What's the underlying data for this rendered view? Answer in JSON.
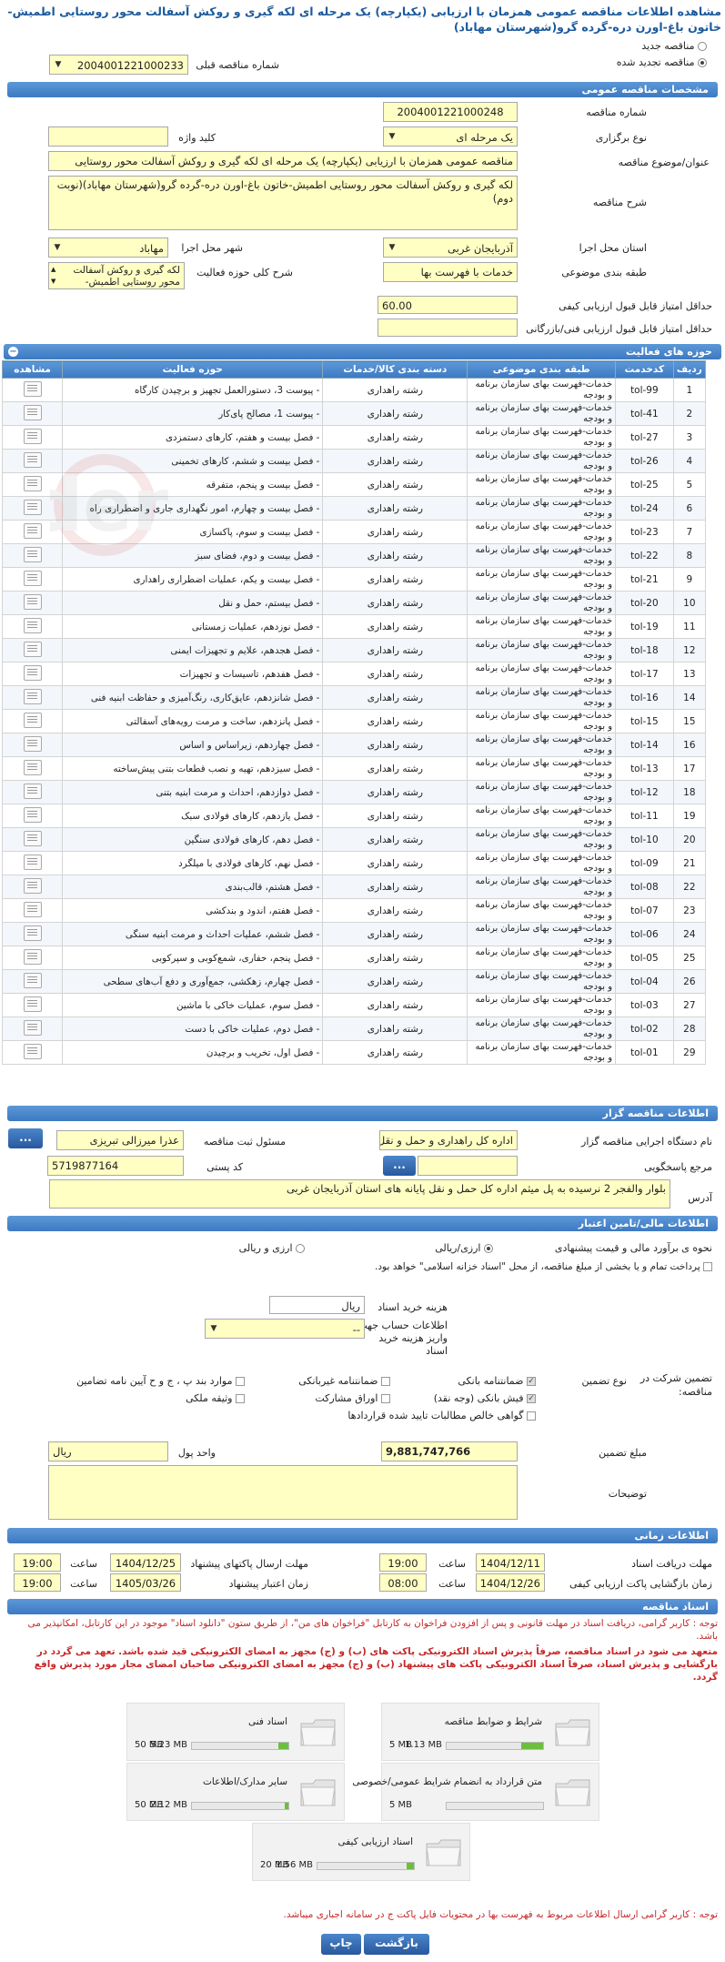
{
  "page": {
    "title": "مشاهده اطلاعات مناقصه عمومی همزمان با ارزیابی (یکپارچه) یک مرحله ای لکه گیری و روکش آسفالت محور روستایی اطمیش-خاتون باغ-اورن دره-گرده گرو(شهرستان مهاباد)"
  },
  "top": {
    "radio_new": "مناقصه جدید",
    "radio_renewed": "مناقصه تجدید شده",
    "prev_number_label": "شماره مناقصه قبلی",
    "prev_number_value": "2004001221000233"
  },
  "general": {
    "header": "مشخصات مناقصه عمومی",
    "number_label": "شماره مناقصه",
    "number_value": "2004001221000248",
    "type_label": "نوع برگزاری",
    "type_value": "یک مرحله ای",
    "keyword_label": "کلید واژه",
    "keyword_value": "",
    "subject_label": "عنوان/موضوع مناقصه",
    "subject_value": "مناقصه عمومی همزمان با ارزیابی (یکپارچه) یک مرحله ای لکه گیری و روکش آسفالت محور روستایی",
    "desc_label": "شرح مناقصه",
    "desc_value": "لکه گیری و روکش آسفالت محور روستایی اطمیش-خاتون باغ-اورن دره-گرده گرو(شهرستان مهاباد)(نوبت دوم)",
    "province_label": "استان محل اجرا",
    "province_value": "آذربایجان غربی",
    "city_label": "شهر محل اجرا",
    "city_value": "مهاباد",
    "category_label": "طبقه بندی موضوعی",
    "category_value": "خدمات با فهرست بها",
    "scope_label": "شرح کلی حوزه فعالیت",
    "scope_value": "لکه گیری و روکش آسفالت محور روستایی اطمیش-",
    "min_quality_label": "حداقل امتیاز قابل قبول ارزیابی کیفی",
    "min_quality_value": "60.00",
    "min_tech_label": "حداقل امتیاز قابل قبول ارزیابی فنی/بازرگانی",
    "min_tech_value": ""
  },
  "activities": {
    "header": "حوزه های فعالیت",
    "columns": [
      "ردیف",
      "کدخدمت",
      "طبقه بندی موضوعی",
      "دسته بندی کالا/خدمات",
      "حوزه فعالیت",
      "مشاهده"
    ],
    "rows": [
      {
        "idx": "1",
        "code": "tol-99",
        "cat": "خدمات-فهرست بهای سازمان برنامه و بودجه",
        "goods": "رشته راهداری",
        "act": "- پیوست 3، دستورالعمل تجهیز و برچیدن کارگاه"
      },
      {
        "idx": "2",
        "code": "tol-41",
        "cat": "خدمات-فهرست بهای سازمان برنامه و بودجه",
        "goods": "رشته راهداری",
        "act": "- پیوست 1، مصالح پای‌کار"
      },
      {
        "idx": "3",
        "code": "tol-27",
        "cat": "خدمات-فهرست بهای سازمان برنامه و بودجه",
        "goods": "رشته راهداری",
        "act": "- فصل بیست و هفتم، کارهای دستمزدی"
      },
      {
        "idx": "4",
        "code": "tol-26",
        "cat": "خدمات-فهرست بهای سازمان برنامه و بودجه",
        "goods": "رشته راهداری",
        "act": "- فصل بیست و ششم، کارهای تخمینی"
      },
      {
        "idx": "5",
        "code": "tol-25",
        "cat": "خدمات-فهرست بهای سازمان برنامه و بودجه",
        "goods": "رشته راهداری",
        "act": "- فصل بیست و پنجم، متفرقه"
      },
      {
        "idx": "6",
        "code": "tol-24",
        "cat": "خدمات-فهرست بهای سازمان برنامه و بودجه",
        "goods": "رشته راهداری",
        "act": "- فصل بیست و چهارم، امور نگهداری جاری و اضطراری راه"
      },
      {
        "idx": "7",
        "code": "tol-23",
        "cat": "خدمات-فهرست بهای سازمان برنامه و بودجه",
        "goods": "رشته راهداری",
        "act": "- فصل بیست و سوم، پاکسازی"
      },
      {
        "idx": "8",
        "code": "tol-22",
        "cat": "خدمات-فهرست بهای سازمان برنامه و بودجه",
        "goods": "رشته راهداری",
        "act": "- فصل بیست و دوم، فضای سبز"
      },
      {
        "idx": "9",
        "code": "tol-21",
        "cat": "خدمات-فهرست بهای سازمان برنامه و بودجه",
        "goods": "رشته راهداری",
        "act": "- فصل بیست و یکم، عملیات اضطراری راهداری"
      },
      {
        "idx": "10",
        "code": "tol-20",
        "cat": "خدمات-فهرست بهای سازمان برنامه و بودجه",
        "goods": "رشته راهداری",
        "act": "- فصل بیستم، حمل و نقل"
      },
      {
        "idx": "11",
        "code": "tol-19",
        "cat": "خدمات-فهرست بهای سازمان برنامه و بودجه",
        "goods": "رشته راهداری",
        "act": "- فصل نوزدهم، عملیات زمستانی"
      },
      {
        "idx": "12",
        "code": "tol-18",
        "cat": "خدمات-فهرست بهای سازمان برنامه و بودجه",
        "goods": "رشته راهداری",
        "act": "- فصل هجدهم، علایم و تجهیزات ایمنی"
      },
      {
        "idx": "13",
        "code": "tol-17",
        "cat": "خدمات-فهرست بهای سازمان برنامه و بودجه",
        "goods": "رشته راهداری",
        "act": "- فصل هفدهم، تاسیسات و تجهیزات"
      },
      {
        "idx": "14",
        "code": "tol-16",
        "cat": "خدمات-فهرست بهای سازمان برنامه و بودجه",
        "goods": "رشته راهداری",
        "act": "- فصل شانزدهم، عایق‌کاری، رنگ‌آمیزی و حفاظت ابنیه فنی"
      },
      {
        "idx": "15",
        "code": "tol-15",
        "cat": "خدمات-فهرست بهای سازمان برنامه و بودجه",
        "goods": "رشته راهداری",
        "act": "- فصل پانزدهم، ساخت و مرمت رویه‌های آسفالتی"
      },
      {
        "idx": "16",
        "code": "tol-14",
        "cat": "خدمات-فهرست بهای سازمان برنامه و بودجه",
        "goods": "رشته راهداری",
        "act": "- فصل چهاردهم، زیراساس و اساس"
      },
      {
        "idx": "17",
        "code": "tol-13",
        "cat": "خدمات-فهرست بهای سازمان برنامه و بودجه",
        "goods": "رشته راهداری",
        "act": "- فصل سیزدهم، تهیه و نصب قطعات بتنی پیش‌ساخته"
      },
      {
        "idx": "18",
        "code": "tol-12",
        "cat": "خدمات-فهرست بهای سازمان برنامه و بودجه",
        "goods": "رشته راهداری",
        "act": "- فصل دوازدهم، احداث و مرمت ابنیه بتنی"
      },
      {
        "idx": "19",
        "code": "tol-11",
        "cat": "خدمات-فهرست بهای سازمان برنامه و بودجه",
        "goods": "رشته راهداری",
        "act": "- فصل یازدهم، کارهای فولادی سبک"
      },
      {
        "idx": "20",
        "code": "tol-10",
        "cat": "خدمات-فهرست بهای سازمان برنامه و بودجه",
        "goods": "رشته راهداری",
        "act": "- فصل دهم، کارهای فولادی سنگین"
      },
      {
        "idx": "21",
        "code": "tol-09",
        "cat": "خدمات-فهرست بهای سازمان برنامه و بودجه",
        "goods": "رشته راهداری",
        "act": "- فصل نهم، کارهای فولادی با میلگرد"
      },
      {
        "idx": "22",
        "code": "tol-08",
        "cat": "خدمات-فهرست بهای سازمان برنامه و بودجه",
        "goods": "رشته راهداری",
        "act": "- فصل هشتم، قالب‌بندی"
      },
      {
        "idx": "23",
        "code": "tol-07",
        "cat": "خدمات-فهرست بهای سازمان برنامه و بودجه",
        "goods": "رشته راهداری",
        "act": "- فصل هفتم، اندود و بندکشی"
      },
      {
        "idx": "24",
        "code": "tol-06",
        "cat": "خدمات-فهرست بهای سازمان برنامه و بودجه",
        "goods": "رشته راهداری",
        "act": "- فصل ششم، عملیات احداث و مرمت ابنیه سنگی"
      },
      {
        "idx": "25",
        "code": "tol-05",
        "cat": "خدمات-فهرست بهای سازمان برنامه و بودجه",
        "goods": "رشته راهداری",
        "act": "- فصل پنجم، حفاری، شمع‌کوبی و سپرکوبی"
      },
      {
        "idx": "26",
        "code": "tol-04",
        "cat": "خدمات-فهرست بهای سازمان برنامه و بودجه",
        "goods": "رشته راهداری",
        "act": "- فصل چهارم، زهکشی، جمع‌آوری و دفع آب‌های سطحی"
      },
      {
        "idx": "27",
        "code": "tol-03",
        "cat": "خدمات-فهرست بهای سازمان برنامه و بودجه",
        "goods": "رشته راهداری",
        "act": "- فصل سوم، عملیات خاکی با ماشین"
      },
      {
        "idx": "28",
        "code": "tol-02",
        "cat": "خدمات-فهرست بهای سازمان برنامه و بودجه",
        "goods": "رشته راهداری",
        "act": "- فصل دوم، عملیات خاکی با دست"
      },
      {
        "idx": "29",
        "code": "tol-01",
        "cat": "خدمات-فهرست بهای سازمان برنامه و بودجه",
        "goods": "رشته راهداری",
        "act": "- فصل اول، تخریب و برچیدن"
      }
    ]
  },
  "organizer": {
    "header": "اطلاعات مناقصه گزار",
    "org_label": "نام دستگاه اجرایی مناقصه گزار",
    "org_value": "اداره کل راهداری و حمل و نقل",
    "resp_label": "مسئول ثبت مناقصه",
    "resp_value": "عذرا میرزالی تبریزی",
    "ref_label": "مرجع پاسخگویی",
    "ref_value": "",
    "postal_label": "کد پستی",
    "postal_value": "5719877164",
    "address_label": "آدرس",
    "address_value": "بلوار والفجر 2 نرسیده به پل میثم اداره کل حمل و نقل پایانه های استان آذربایجان غربی",
    "btn_more": "...",
    "btn_more2": "..."
  },
  "finance": {
    "header": "اطلاعات مالی/تامین اعتبار",
    "estimate_label": "نحوه ی برآورد مالی و قیمت پیشنهادی",
    "estimate_opt1": "ارزی/ریالی",
    "estimate_opt2": "ارزی و ریالی",
    "treasury_note": "پرداخت تمام و یا بخشی از مبلغ مناقصه، از محل \"اسناد خزانه اسلامی\" خواهد بود.",
    "doc_fee_label": "هزینه خرید اسناد",
    "doc_fee_unit": "ریال",
    "doc_fee_value": "",
    "account_label": "اطلاعات حساب جهت واریز هزینه خرید اسناد",
    "account_value": "--",
    "participation_label": "تضمین شرکت در مناقصه:",
    "guarantee_type_label": "نوع تضمین",
    "g1": "ضمانتنامه بانکی",
    "g2": "ضمانتنامه غیربانکی",
    "g3": "موارد بند پ ، ج و ح آیین نامه تضامین",
    "g4": "فیش بانکی (وجه نقد)",
    "g5": "اوراق مشارکت",
    "g6": "وثیقه ملکی",
    "g7": "گواهی خالص مطالبات تایید شده قراردادها",
    "amount_label": "مبلغ تضمین",
    "amount_value": "9,881,747,766",
    "currency_label": "واحد پول",
    "currency_value": "ریال",
    "notes_label": "توضیحات",
    "notes_value": ""
  },
  "timing": {
    "header": "اطلاعات زمانی",
    "receive_label": "مهلت دریافت اسناد",
    "receive_date": "1404/12/11",
    "receive_time": "19:00",
    "send_label": "مهلت ارسال پاکتهای پیشنهاد",
    "send_date": "1404/12/25",
    "send_time": "19:00",
    "open_label": "زمان بازگشایی پاکت ارزیابی کیفی",
    "open_date": "1404/12/26",
    "open_time": "08:00",
    "valid_label": "زمان اعتبار پیشنهاد",
    "valid_date": "1405/03/26",
    "valid_time": "19:00",
    "time_word": "ساعت"
  },
  "docs": {
    "header": "اسناد مناقصه",
    "note1": "توجه : کاربر گرامی، دریافت اسناد در مهلت قانونی و پس از افزودن فراخوان به کارتابل \"فراخوان های من\"، از طریق ستون \"دانلود اسناد\" موجود در این کارتابل، امکانپذیر می باشد.",
    "note2": "متعهد می شود در اسناد مناقصه، صرفاً پذیرش اسناد الکترونیکی پاکت های (ب) و (ج) مجهز به امضای الکترونیکی قید شده باشد. تعهد می گردد در بارگشایی و پذیرش اسناد، صرفاً اسناد الکترونیکی پاکت های پیشنهاد (ب) و (ج) مجهز به امضای الکترونیکی صاحبان امضای مجاز مورد پذیرش واقع گردد.",
    "files": [
      {
        "name": "شرایط و ضوابط مناقصه",
        "current": "1.13 MB",
        "max": "5 MB",
        "ratio": 0.23
      },
      {
        "name": "اسناد فنی",
        "current": "5.23 MB",
        "max": "50 MB",
        "ratio": 0.1
      },
      {
        "name": "متن قرارداد به انضمام شرایط عمومی/خصوصی",
        "current": "",
        "max": "5 MB",
        "ratio": 0.0
      },
      {
        "name": "سایر مدارک/اطلاعات",
        "current": "2.12 MB",
        "max": "50 MB",
        "ratio": 0.04
      },
      {
        "name": "اسناد ارزیابی کیفی",
        "current": "1.56 MB",
        "max": "20 MB",
        "ratio": 0.08
      }
    ],
    "note3": "توجه : کاربر گرامی ارسال اطلاعات مربوط به فهرست بها در محتویات فایل پاکت ج در سامانه اجباری میباشد."
  },
  "footer": {
    "back": "بازگشت",
    "print": "چاپ"
  }
}
